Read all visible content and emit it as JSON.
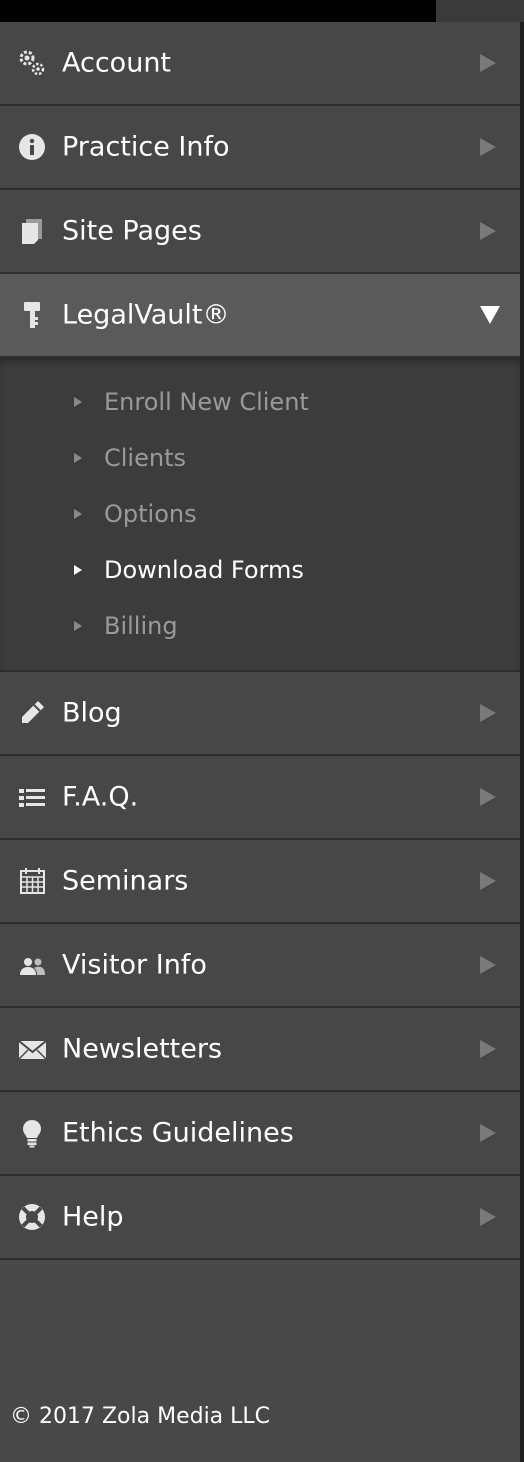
{
  "nav": {
    "items": [
      {
        "label": "Account",
        "icon": "gears-icon"
      },
      {
        "label": "Practice Info",
        "icon": "info-icon"
      },
      {
        "label": "Site Pages",
        "icon": "pages-icon"
      },
      {
        "label": "LegalVault®",
        "icon": "key-icon",
        "expanded": true
      },
      {
        "label": "Blog",
        "icon": "pencil-icon"
      },
      {
        "label": "F.A.Q.",
        "icon": "list-icon"
      },
      {
        "label": "Seminars",
        "icon": "calendar-icon"
      },
      {
        "label": "Visitor Info",
        "icon": "users-icon"
      },
      {
        "label": "Newsletters",
        "icon": "envelope-icon"
      },
      {
        "label": "Ethics Guidelines",
        "icon": "lightbulb-icon"
      },
      {
        "label": "Help",
        "icon": "lifebuoy-icon"
      }
    ]
  },
  "submenu": {
    "items": [
      {
        "label": "Enroll New Client"
      },
      {
        "label": "Clients"
      },
      {
        "label": "Options"
      },
      {
        "label": "Download Forms",
        "current": true
      },
      {
        "label": "Billing"
      }
    ]
  },
  "footer": {
    "copyright": "© 2017 Zola Media LLC"
  },
  "colors": {
    "background": "#484848",
    "active_item": "#5a5a5a",
    "submenu_bg": "#3c3c3c",
    "text": "#ffffff",
    "muted_text": "#9a9a9a"
  }
}
